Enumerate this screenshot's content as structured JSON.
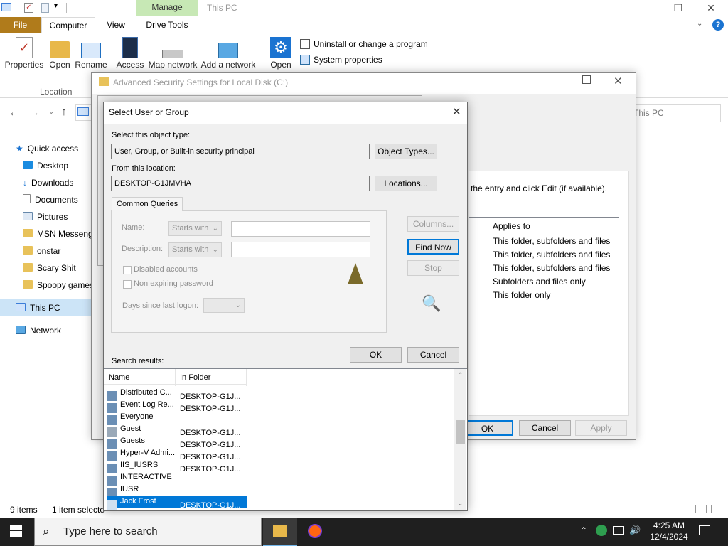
{
  "explorer": {
    "title": "This PC",
    "context_tab": "Manage",
    "tabs": {
      "file": "File",
      "computer": "Computer",
      "view": "View",
      "drive_tools": "Drive Tools"
    },
    "ribbon": {
      "properties": "Properties",
      "open": "Open",
      "rename": "Rename",
      "access": "Access",
      "map_network": "Map network",
      "add_network": "Add a network",
      "open2": "Open",
      "uninstall": "Uninstall or change a program",
      "system_properties": "System properties",
      "group_location": "Location"
    },
    "address_partial": "This PC",
    "nav": {
      "quick_access": "Quick access",
      "items": [
        "Desktop",
        "Downloads",
        "Documents",
        "Pictures",
        "MSN Messeng",
        "onstar",
        "Scary Shit",
        "Spoopy games"
      ],
      "this_pc": "This PC",
      "network": "Network"
    },
    "status": {
      "items": "9 items",
      "selected": "1 item selecte"
    }
  },
  "adv_security": {
    "title": "Advanced Security Settings for Local Disk (C:)",
    "instruction_partial": "the entry and click Edit (if available).",
    "applies_header": "Applies to",
    "applies_rows": [
      "This folder, subfolders and files",
      "This folder, subfolders and files",
      "This folder, subfolders and files",
      "Subfolders and files only",
      "This folder only"
    ],
    "buttons": {
      "ok": "OK",
      "cancel": "Cancel",
      "apply": "Apply"
    }
  },
  "dialog": {
    "title": "Select User or Group",
    "object_type_label": "Select this object type:",
    "object_type_value": "User, Group, or Built-in security principal",
    "object_types_btn": "Object Types...",
    "location_label": "From this location:",
    "location_value": "DESKTOP-G1JMVHA",
    "locations_btn": "Locations...",
    "queries_tab": "Common Queries",
    "name_label": "Name:",
    "desc_label": "Description:",
    "starts_with": "Starts with",
    "disabled_accounts": "Disabled accounts",
    "non_expiring": "Non expiring password",
    "days_since_logon": "Days since last logon:",
    "columns_btn": "Columns...",
    "find_now_btn": "Find Now",
    "stop_btn": "Stop",
    "ok_btn": "OK",
    "cancel_btn": "Cancel",
    "search_results_label": "Search results:",
    "result_columns": {
      "name": "Name",
      "folder": "In Folder"
    },
    "results": [
      {
        "name": "Distributed C...",
        "folder": "DESKTOP-G1J..."
      },
      {
        "name": "Event Log Re...",
        "folder": "DESKTOP-G1J..."
      },
      {
        "name": "Everyone",
        "folder": ""
      },
      {
        "name": "Guest",
        "folder": "DESKTOP-G1J..."
      },
      {
        "name": "Guests",
        "folder": "DESKTOP-G1J..."
      },
      {
        "name": "Hyper-V Admi...",
        "folder": "DESKTOP-G1J..."
      },
      {
        "name": "IIS_IUSRS",
        "folder": "DESKTOP-G1J..."
      },
      {
        "name": "INTERACTIVE",
        "folder": ""
      },
      {
        "name": "IUSR",
        "folder": ""
      },
      {
        "name": "Jack Frost",
        "folder": "DESKTOP-G1J..."
      }
    ]
  },
  "taskbar": {
    "search_placeholder": "Type here to search",
    "time": "4:25 AM",
    "date": "12/4/2024"
  }
}
